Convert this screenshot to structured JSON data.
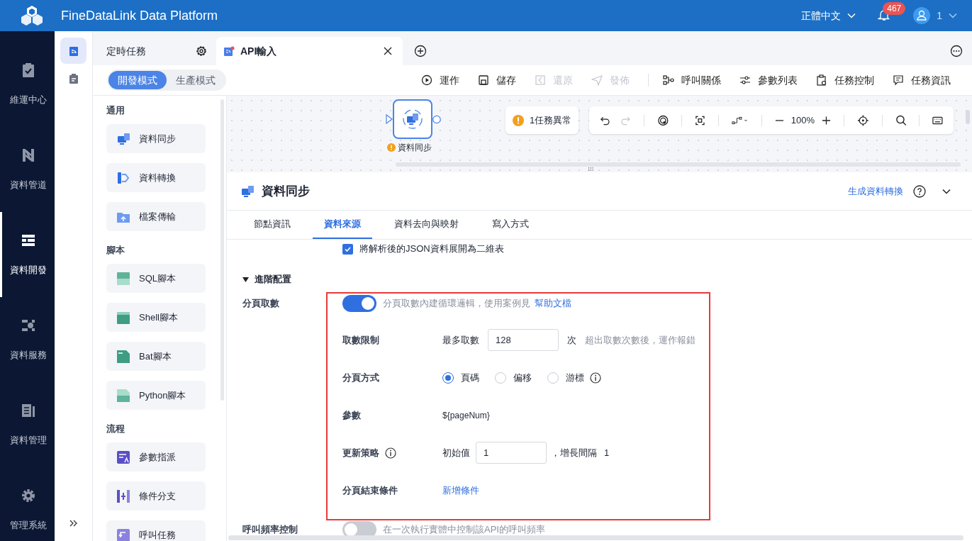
{
  "header": {
    "title": "FineDataLink Data Platform",
    "language": "正體中文",
    "notifications": "467",
    "user": "1"
  },
  "nav": [
    {
      "label": "維運中心",
      "selected": false,
      "kind": "ops"
    },
    {
      "label": "資料管道",
      "selected": false,
      "kind": "pipe"
    },
    {
      "label": "資料開發",
      "selected": true,
      "kind": "dev"
    },
    {
      "label": "資料服務",
      "selected": false,
      "kind": "service"
    },
    {
      "label": "資料管理",
      "selected": false,
      "kind": "manage"
    },
    {
      "label": "管理系統",
      "selected": false,
      "kind": "system"
    }
  ],
  "side_icons": [
    {
      "selected": true
    },
    {
      "selected": false
    }
  ],
  "tabs": [
    {
      "label": "定時任務",
      "selected": false,
      "kind": "folder"
    },
    {
      "label": "API輸入",
      "selected": true,
      "kind": "task"
    }
  ],
  "modes": [
    {
      "label": "開發模式",
      "selected": true
    },
    {
      "label": "生產模式",
      "selected": false
    }
  ],
  "actions": [
    {
      "label": "運作",
      "disabled": false,
      "kind": "run"
    },
    {
      "label": "儲存",
      "disabled": false,
      "kind": "save"
    },
    {
      "label": "還原",
      "disabled": true,
      "kind": "revert"
    },
    {
      "label": "發佈",
      "disabled": true,
      "kind": "publish"
    },
    {
      "label": "呼叫關係",
      "disabled": false,
      "kind": "relation"
    },
    {
      "label": "參數列表",
      "disabled": false,
      "kind": "params"
    },
    {
      "label": "任務控制",
      "disabled": false,
      "kind": "control"
    },
    {
      "label": "任務資訊",
      "disabled": false,
      "kind": "info"
    }
  ],
  "palette": [
    {
      "title": "通用",
      "items": [
        {
          "label": "資料同步",
          "kind": "sync"
        },
        {
          "label": "資料轉換",
          "kind": "transform"
        },
        {
          "label": "檔案傳輸",
          "kind": "file"
        }
      ]
    },
    {
      "title": "腳本",
      "items": [
        {
          "label": "SQL腳本",
          "kind": "sql"
        },
        {
          "label": "Shell腳本",
          "kind": "shell"
        },
        {
          "label": "Bat腳本",
          "kind": "bat"
        },
        {
          "label": "Python腳本",
          "kind": "python"
        }
      ]
    },
    {
      "title": "流程",
      "items": [
        {
          "label": "參數指派",
          "kind": "assign"
        },
        {
          "label": "條件分支",
          "kind": "branch"
        },
        {
          "label": "呼叫任務",
          "kind": "call"
        }
      ]
    }
  ],
  "canvas": {
    "node": "資料同步",
    "alert": "1任務異常",
    "zoom": "100%"
  },
  "panel": {
    "title": "資料同步",
    "link": "生成資料轉換",
    "tabs": [
      {
        "label": "節點資訊",
        "selected": false
      },
      {
        "label": "資料來源",
        "selected": true
      },
      {
        "label": "資料去向與映射",
        "selected": false
      },
      {
        "label": "寫入方式",
        "selected": false
      }
    ],
    "checkbox": {
      "label": "將解析後的JSON資料展開為二維表",
      "checked": true
    },
    "section": {
      "title": "進階配置",
      "expanded": true
    },
    "paging": {
      "label": "分頁取數",
      "on": true,
      "hint": "分頁取數內建循環邏輯，使用案例見",
      "link": "幫助文檔"
    },
    "rows": [
      {
        "kind": "limit",
        "label": "取數限制",
        "info": false,
        "prefix": "最多取數",
        "value": "128",
        "unit": "次",
        "hint": "超出取數次數後，運作報錯"
      },
      {
        "kind": "radio",
        "label": "分頁方式",
        "info": false,
        "options": [
          {
            "label": "頁碼",
            "selected": true,
            "info": false
          },
          {
            "label": "偏移",
            "selected": false,
            "info": false
          },
          {
            "label": "游標",
            "selected": false,
            "info": true
          }
        ]
      },
      {
        "kind": "text",
        "label": "參數",
        "info": false,
        "value": "${pageNum}"
      },
      {
        "kind": "strategy",
        "label": "更新策略",
        "info": true,
        "prefix": "初始值",
        "value": "1",
        "step_label": "，增長間隔",
        "step": "1"
      },
      {
        "kind": "link",
        "label": "分頁結束條件",
        "info": false,
        "link": "新增條件"
      }
    ],
    "rate": {
      "label": "呼叫頻率控制",
      "on": false,
      "hint": "在一次執行實體中控制該API的呼叫頻率"
    }
  }
}
